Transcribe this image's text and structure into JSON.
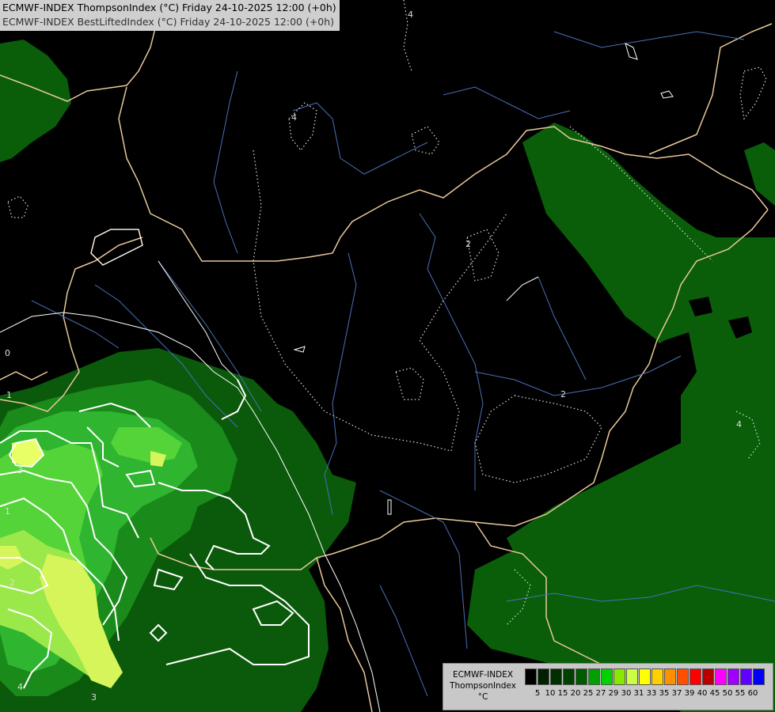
{
  "header": {
    "line1": "ECMWF-INDEX ThompsonIndex (°C) Friday 24-10-2025 12:00 (+0h)",
    "line2": "ECMWF-INDEX BestLiftedIndex (°C) Friday 24-10-2025 12:00 (+0h)"
  },
  "map": {
    "contour_labels": [
      "4",
      "4",
      "2",
      "2",
      "4",
      "0",
      "1",
      "3",
      "1",
      "2",
      "4",
      "3"
    ]
  },
  "legend": {
    "model": "ECMWF-INDEX",
    "variable": "ThompsonIndex",
    "unit": "°C",
    "ticks": [
      "5",
      "10",
      "15",
      "20",
      "25",
      "27",
      "29",
      "30",
      "31",
      "33",
      "35",
      "37",
      "39",
      "40",
      "45",
      "50",
      "55",
      "60"
    ],
    "colors": [
      "#000000",
      "#002000",
      "#003000",
      "#004000",
      "#005a00",
      "#00a000",
      "#00d400",
      "#88e800",
      "#ccff44",
      "#ffff00",
      "#ffd000",
      "#ff9000",
      "#ff5000",
      "#ff0000",
      "#b80000",
      "#ff00ff",
      "#a000ff",
      "#6000ff",
      "#0000ff"
    ]
  }
}
